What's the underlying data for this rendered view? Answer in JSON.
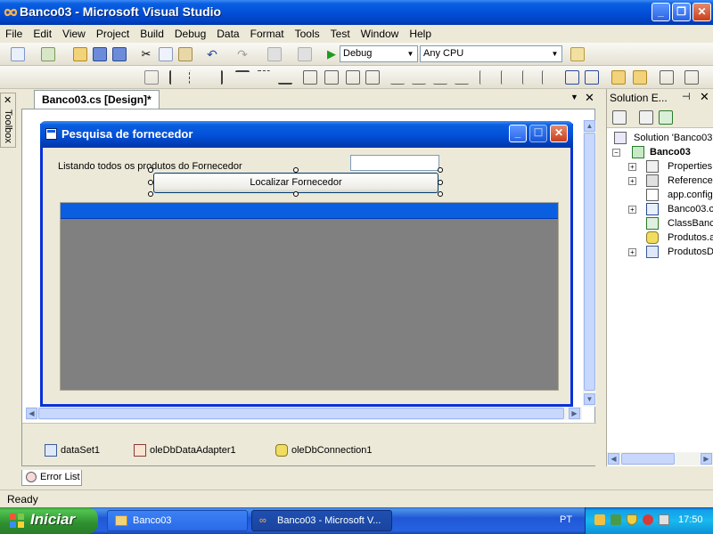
{
  "window": {
    "title": "Banco03 - Microsoft Visual Studio"
  },
  "menu": [
    "File",
    "Edit",
    "View",
    "Project",
    "Build",
    "Debug",
    "Data",
    "Format",
    "Tools",
    "Test",
    "Window",
    "Help"
  ],
  "toolbar": {
    "config": "Debug",
    "platform": "Any CPU"
  },
  "document_tab": "Banco03.cs [Design]*",
  "toolbox_label": "Toolbox",
  "form": {
    "title": "Pesquisa de fornecedor",
    "label": "Listando todos os produtos do Fornecedor",
    "textbox_value": "",
    "button": "Localizar Fornecedor"
  },
  "component_tray": [
    "dataSet1",
    "oleDbDataAdapter1",
    "oleDbConnection1"
  ],
  "solution_explorer": {
    "title": "Solution E...",
    "items": [
      {
        "label": "Solution 'Banco03'"
      },
      {
        "label": "Banco03"
      },
      {
        "label": "Properties"
      },
      {
        "label": "Reference"
      },
      {
        "label": "app.config"
      },
      {
        "label": "Banco03.c"
      },
      {
        "label": "ClassBanco"
      },
      {
        "label": "Produtos.a"
      },
      {
        "label": "ProdutosD"
      }
    ]
  },
  "error_list_tab": "Error List",
  "status": "Ready",
  "taskbar": {
    "start": "Iniciar",
    "buttons": [
      "Banco03",
      "Banco03 - Microsoft V..."
    ],
    "lang": "PT",
    "clock": "17:50"
  },
  "colors": {
    "xp_blue": "#0a5fe0",
    "grid_gray": "#808080",
    "form_back": "#ece9d8"
  }
}
